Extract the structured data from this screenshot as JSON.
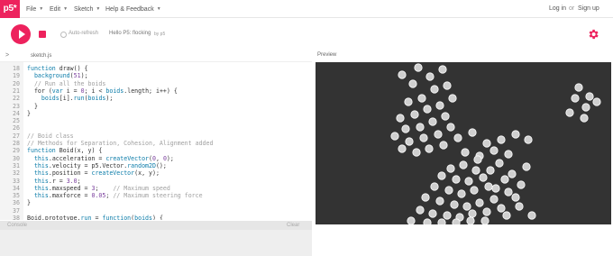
{
  "nav": {
    "logo": "p5*",
    "menus": [
      "File",
      "Edit",
      "Sketch",
      "Help & Feedback"
    ],
    "login": "Log in",
    "or": "or",
    "signup": "Sign up"
  },
  "toolbar": {
    "auto_refresh": "Auto-refresh",
    "sketch_name": "Hello P5: flocking",
    "owner": "by p5"
  },
  "editor": {
    "file_name": "sketch.js",
    "lines": [
      {
        "n": "18",
        "t": "function draw() {"
      },
      {
        "n": "19",
        "t": "  background(51);"
      },
      {
        "n": "20",
        "t": "  // Run all the boids"
      },
      {
        "n": "21",
        "t": "  for (var i = 0; i < boids.length; i++) {"
      },
      {
        "n": "22",
        "t": "    boids[i].run(boids);"
      },
      {
        "n": "23",
        "t": "  }"
      },
      {
        "n": "24",
        "t": "}"
      },
      {
        "n": "25",
        "t": ""
      },
      {
        "n": "26",
        "t": ""
      },
      {
        "n": "27",
        "t": "// Boid class"
      },
      {
        "n": "28",
        "t": "// Methods for Separation, Cohesion, Alignment added"
      },
      {
        "n": "29",
        "t": "function Boid(x, y) {"
      },
      {
        "n": "30",
        "t": "  this.acceleration = createVector(0, 0);"
      },
      {
        "n": "31",
        "t": "  this.velocity = p5.Vector.random2D();"
      },
      {
        "n": "32",
        "t": "  this.position = createVector(x, y);"
      },
      {
        "n": "33",
        "t": "  this.r = 3.0;"
      },
      {
        "n": "34",
        "t": "  this.maxspeed = 3;    // Maximum speed"
      },
      {
        "n": "35",
        "t": "  this.maxforce = 0.05; // Maximum steering force"
      },
      {
        "n": "36",
        "t": "}"
      },
      {
        "n": "37",
        "t": ""
      },
      {
        "n": "38",
        "t": "Boid.prototype.run = function(boids) {"
      }
    ]
  },
  "console": {
    "title": "Console",
    "clear": "Clear"
  },
  "preview": {
    "label": "Preview",
    "background": "#333333",
    "boid_fill": "#cfcfcf",
    "boid_stroke": "#ffffff"
  },
  "colors": {
    "accent": "#ed225d"
  }
}
